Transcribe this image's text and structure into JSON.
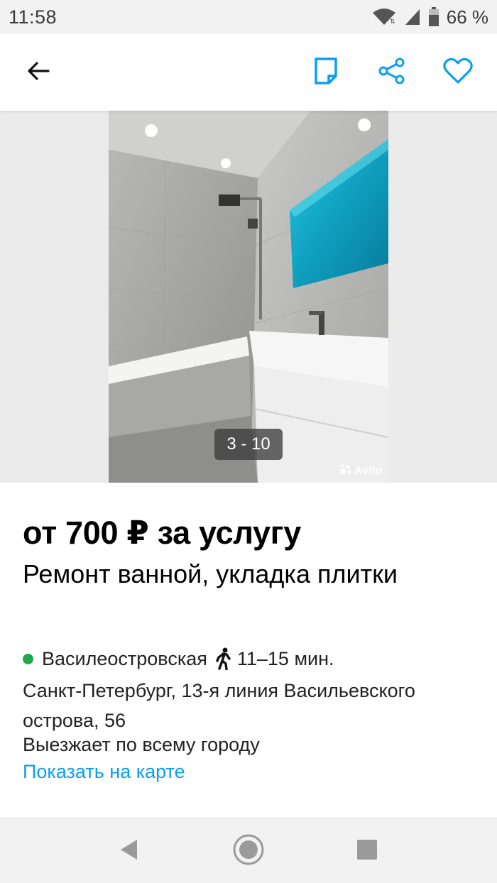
{
  "status": {
    "time": "11:58",
    "battery": "66 %",
    "icons": [
      "wifi-icon",
      "signal-icon",
      "battery-icon"
    ]
  },
  "header": {
    "icons": [
      "back-arrow-icon",
      "note-icon",
      "share-icon",
      "heart-icon"
    ],
    "accent_color": "#0a9ef5"
  },
  "gallery": {
    "counter": "3 - 10",
    "watermark": "Avito"
  },
  "listing": {
    "price": "от 700 ₽ за услугу",
    "title": "Ремонт ванной, укладка плитки",
    "metro": "Василеостровская",
    "metro_color": "#1fa94a",
    "walk_time": "11–15 мин.",
    "address": "Санкт-Петербург, 13-я линия Васильевского острова, 56",
    "travel": "Выезжает по всему городу",
    "map_link": "Показать на карте"
  },
  "nav": {
    "icons": [
      "nav-back-icon",
      "nav-home-icon",
      "nav-recent-icon"
    ]
  }
}
